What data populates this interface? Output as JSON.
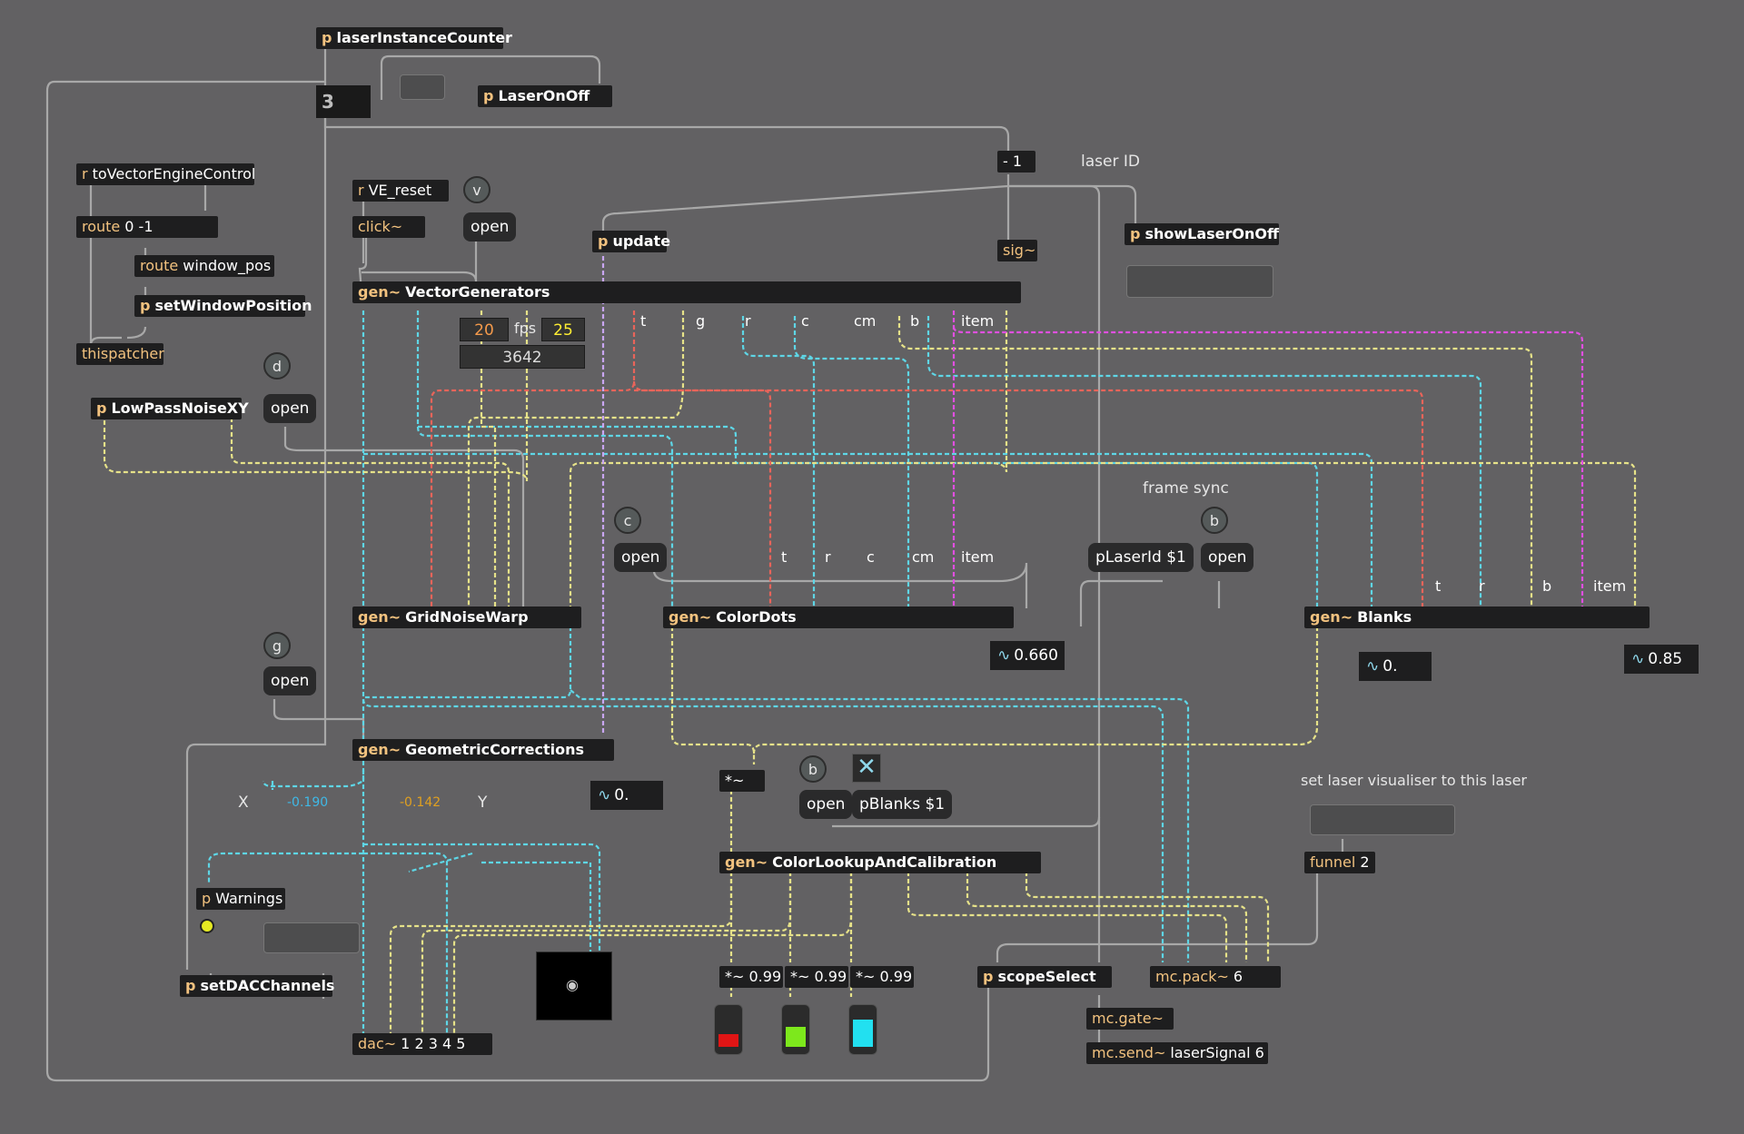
{
  "objects": {
    "laserInstanceCounter": {
      "kw": "p",
      "text": "laserInstanceCounter"
    },
    "instanceNumber": "3",
    "laserOnOff": {
      "kw": "p",
      "text": "LaserOnOff"
    },
    "toVectorEngineControl": {
      "kw": "r",
      "text": "toVectorEngineControl"
    },
    "route": {
      "kw": "route",
      "text": "0 -1"
    },
    "routeWindowPos": {
      "kw": "route",
      "text": "window_pos"
    },
    "setWindowPosition": {
      "kw": "p",
      "text": "setWindowPosition"
    },
    "thispatcher": "thispatcher",
    "lowPassNoise": {
      "kw": "p",
      "text": "LowPassNoiseXY"
    },
    "veReset": {
      "kw": "r",
      "text": "VE_reset"
    },
    "click": "click~",
    "update": {
      "kw": "p",
      "text": "update"
    },
    "minus1": "- 1",
    "sig": "sig~",
    "showLaserOnOff": {
      "kw": "p",
      "text": "showLaserOnOff"
    },
    "vectorGenerators": {
      "kw": "gen~",
      "text": "VectorGenerators"
    },
    "gridNoiseWarp": {
      "kw": "gen~",
      "text": "GridNoiseWarp"
    },
    "colorDots": {
      "kw": "gen~",
      "text": "ColorDots"
    },
    "blanks": {
      "kw": "gen~",
      "text": "Blanks"
    },
    "geometricCorrections": {
      "kw": "gen~",
      "text": "GeometricCorrections"
    },
    "mult": "*~",
    "colorLookup": {
      "kw": "gen~",
      "text": "ColorLookupAndCalibration"
    },
    "funnel": {
      "kw": "funnel",
      "text": "2"
    },
    "warnings": {
      "kw": "p",
      "text": "Warnings"
    },
    "setDACChannels": {
      "kw": "p",
      "text": "setDACChannels"
    },
    "dac": {
      "kw": "dac~",
      "text": "1 2 3 4 5"
    },
    "gainR": "*~ 0.99",
    "gainG": "*~ 0.99",
    "gainB": "*~ 0.99",
    "scopeSelect": {
      "kw": "p",
      "text": "scopeSelect"
    },
    "mcPack": {
      "kw": "mc.pack~",
      "text": "6"
    },
    "mcGate": "mc.gate~",
    "mcSend": {
      "kw": "mc.send~",
      "text": "laserSignal 6"
    }
  },
  "messages": {
    "openV": "open",
    "openD": "open",
    "openC": "open",
    "openB1": "open",
    "openG": "open",
    "openB2": "open",
    "pLaserId": "pLaserId $1",
    "pBlanks": "pBlanks $1"
  },
  "bangs": {
    "v": "v",
    "d": "d",
    "c": "c",
    "b1": "b",
    "g": "g",
    "b2": "b"
  },
  "numbers": {
    "fps_left": "20",
    "fps_label": "fps",
    "fps_right": "25",
    "counter": "3642",
    "colorDotsOut": "0.660",
    "blanksOut1": "0.",
    "blanksOut2": "0.85",
    "geoOut": "0.",
    "xValue": "-0.190",
    "yValue": "-0.142"
  },
  "labels": {
    "laserId": "laser ID",
    "frameSync": "frame sync",
    "setVisualiser": "set  laser visualiser to this laser",
    "x": "X",
    "y": "Y",
    "outlet_t": "t",
    "outlet_g": "g",
    "outlet_r": "r",
    "outlet_c": "c",
    "outlet_cm": "cm",
    "outlet_b": "b",
    "outlet_item": "item",
    "cd_t": "t",
    "cd_r": "r",
    "cd_c": "c",
    "cd_cm": "cm",
    "cd_item": "item",
    "bl_t": "t",
    "bl_r": "r",
    "bl_b": "b",
    "bl_item": "item"
  },
  "colors": {
    "background": "#626163",
    "cordGray": "#a8a8a8",
    "signalCyan": "#5ed6e6",
    "signalYellow": "#e6e289",
    "signalRed": "#e8645a",
    "signalMagenta": "#e04fe0",
    "signalLilac": "#c9a6f2",
    "meterRed": "#e01515",
    "meterGreen": "#7de81c",
    "meterCyan": "#22e0f0"
  },
  "icons": {
    "toggle": "x-mark-icon",
    "scope": "eye-icon"
  }
}
